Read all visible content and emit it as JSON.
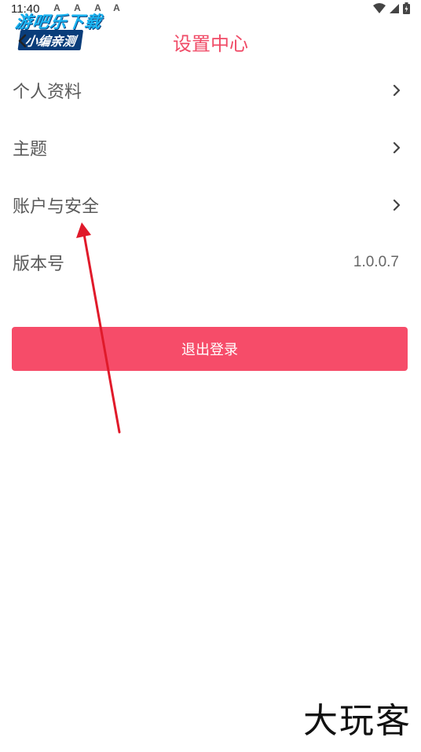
{
  "status_bar": {
    "time": "11:40",
    "notifications": [
      "A",
      "A",
      "A",
      "A"
    ]
  },
  "watermark": {
    "line1": "游吧乐下载",
    "line2": "小编亲测"
  },
  "header": {
    "title": "设置中心"
  },
  "settings": {
    "items": [
      {
        "label": "个人资料",
        "type": "link"
      },
      {
        "label": "主题",
        "type": "link"
      },
      {
        "label": "账户与安全",
        "type": "link"
      },
      {
        "label": "版本号",
        "type": "value",
        "value": "1.0.0.7"
      }
    ]
  },
  "logout": {
    "label": "退出登录"
  },
  "brand": {
    "logo_text": "大玩客"
  },
  "colors": {
    "accent": "#f04a66",
    "button": "#f64c69",
    "arrow": "#e01a2a"
  }
}
